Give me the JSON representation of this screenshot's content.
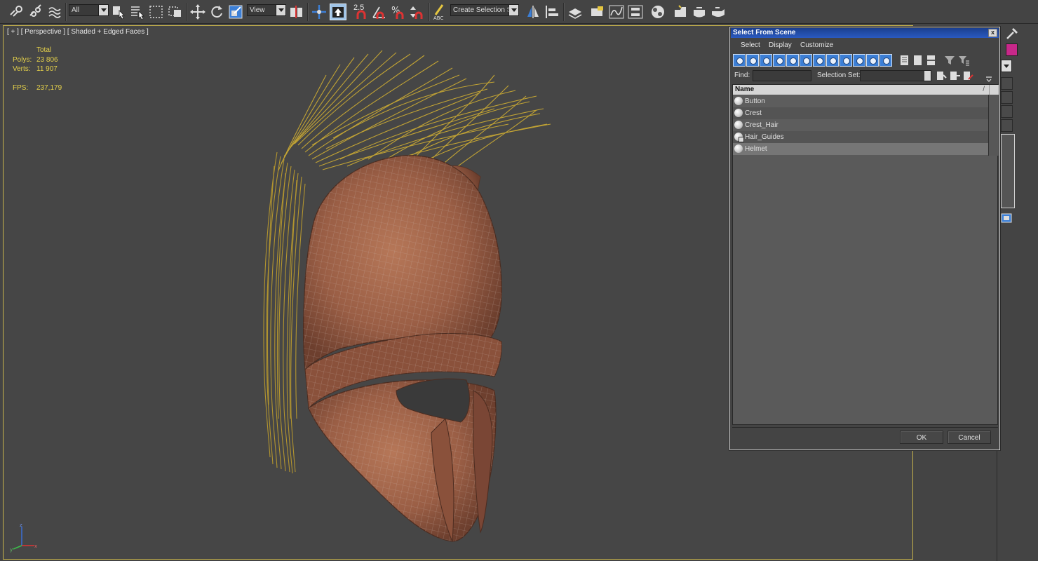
{
  "toolbar": {
    "selection_filter": "All",
    "reference_coord": "View",
    "snap_value": "2.5",
    "selection_set_placeholder": "Create Selection Se"
  },
  "viewport": {
    "label": "[ + ] [ Perspective ] [ Shaded + Edged Faces ]",
    "stats": {
      "total_label": "Total",
      "polys_label": "Polys:",
      "polys_value": "23 806",
      "verts_label": "Verts:",
      "verts_value": "11 907",
      "fps_label": "FPS:",
      "fps_value": "237,179"
    },
    "axis": {
      "z": "z",
      "x": "x",
      "y": "y"
    }
  },
  "dialog": {
    "title": "Select From Scene",
    "close": "x",
    "menu": [
      "Select",
      "Display",
      "Customize"
    ],
    "find_label": "Find:",
    "find_value": "",
    "selection_set_label": "Selection Set:",
    "selection_set_value": "",
    "column_header": "Name",
    "sort_indicator": "/",
    "rows": [
      {
        "name": "Button",
        "icon": "geometry-icon"
      },
      {
        "name": "Crest",
        "icon": "geometry-icon"
      },
      {
        "name": "Crest_Hair",
        "icon": "geometry-icon"
      },
      {
        "name": "Hair_Guides",
        "icon": "hair-guides-icon"
      },
      {
        "name": "Helmet",
        "icon": "geometry-icon"
      }
    ],
    "ok_label": "OK",
    "cancel_label": "Cancel"
  },
  "colors": {
    "viewport_border": "#c7b34b",
    "stats_text": "#e5d14a",
    "title_bar": "#2a5ac0",
    "helmet_copper": "#a0654a",
    "crest_hair": "#c8a834"
  }
}
